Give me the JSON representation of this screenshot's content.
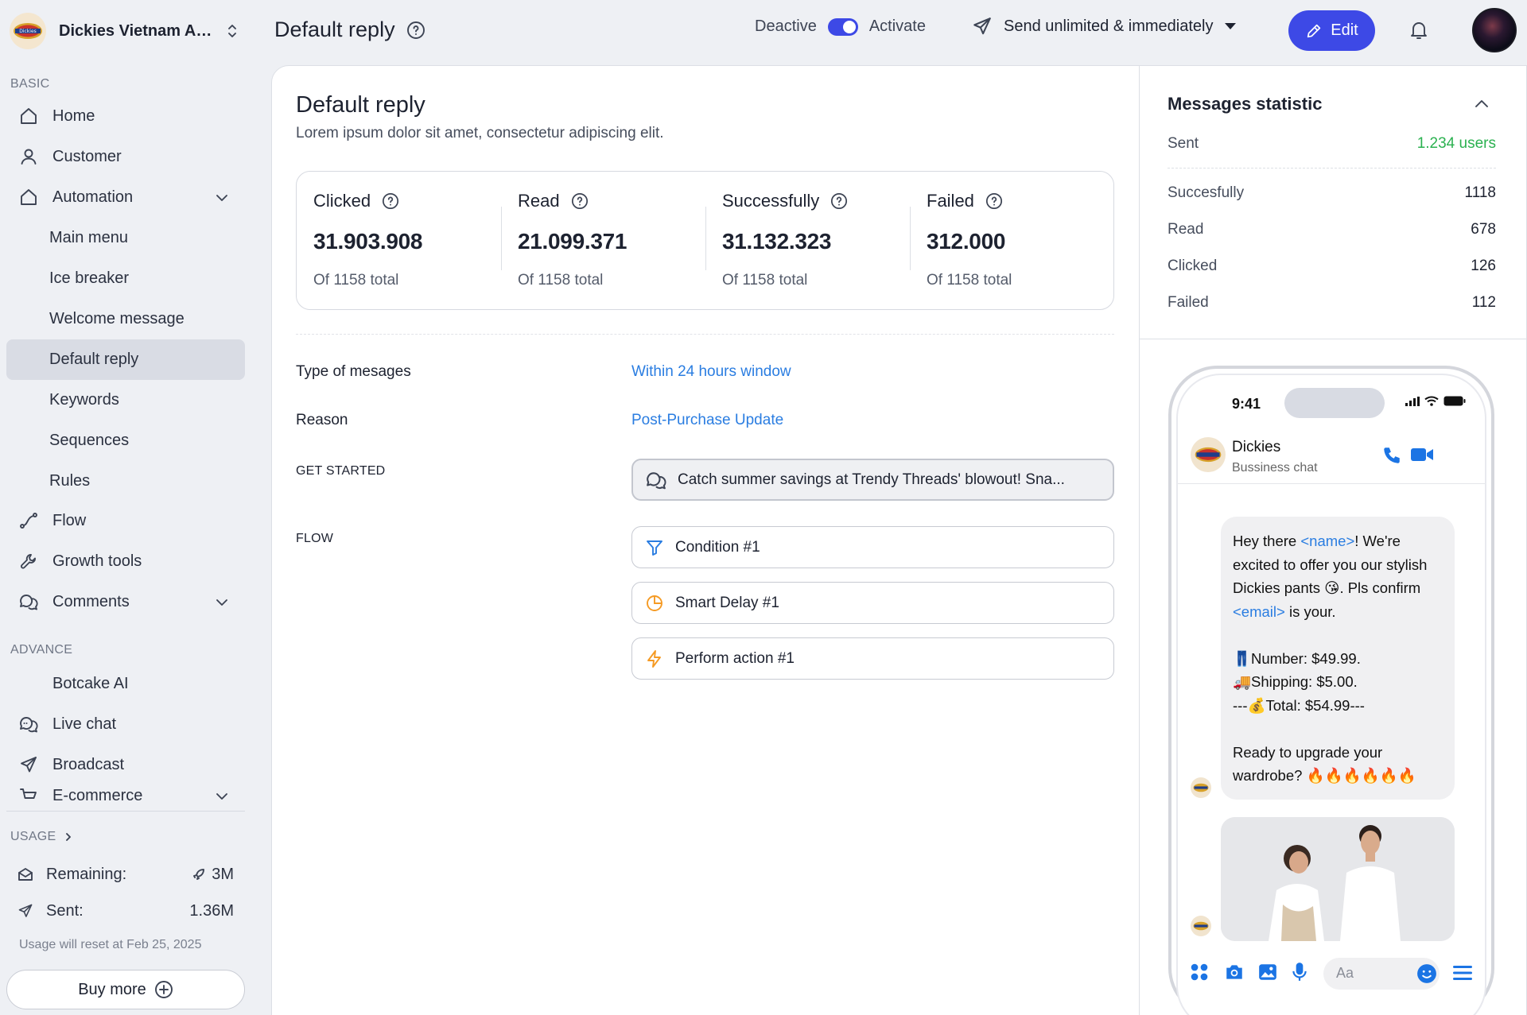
{
  "workspace": {
    "name": "Dickies Vietnam Aut...",
    "logo_text": "Dickies"
  },
  "sidebar": {
    "basic_label": "BASIC",
    "basic_items": [
      {
        "label": "Home",
        "icon": "home-icon"
      },
      {
        "label": "Customer",
        "icon": "user-icon"
      },
      {
        "label": "Automation",
        "icon": "home-icon",
        "expanded": true
      }
    ],
    "automation_children": [
      {
        "label": "Main menu"
      },
      {
        "label": "Ice breaker"
      },
      {
        "label": "Welcome message"
      },
      {
        "label": "Default reply",
        "active": true
      },
      {
        "label": "Keywords"
      },
      {
        "label": "Sequences"
      },
      {
        "label": "Rules"
      }
    ],
    "other_items": [
      {
        "label": "Flow",
        "icon": "flow-icon"
      },
      {
        "label": "Growth tools",
        "icon": "wrench-icon"
      },
      {
        "label": "Comments",
        "icon": "comments-icon"
      }
    ],
    "advance_label": "ADVANCE",
    "advance_items": [
      {
        "label": "Botcake AI"
      },
      {
        "label": "Live chat",
        "icon": "live-chat-icon"
      },
      {
        "label": "Broadcast",
        "icon": "send-icon"
      },
      {
        "label": "E-commerce",
        "icon": "cart-icon"
      }
    ],
    "usage_label": "USAGE",
    "usage": {
      "remaining_label": "Remaining:",
      "remaining_value": "3M",
      "sent_label": "Sent:",
      "sent_value": "1.36M",
      "reset_note": "Usage will reset at Feb 25, 2025"
    },
    "buy_more_label": "Buy more"
  },
  "header": {
    "title": "Default reply",
    "deactive_label": "Deactive",
    "activate_label": "Activate",
    "toggle_on": true,
    "send_mode": "Send unlimited & immediately",
    "edit_label": "Edit",
    "accent_color": "#3d49e6"
  },
  "content": {
    "title": "Default reply",
    "description": "Lorem ipsum dolor sit amet, consectetur adipiscing elit.",
    "stats": [
      {
        "label": "Clicked",
        "value": "31.903.908",
        "sub": "Of 1158 total"
      },
      {
        "label": "Read",
        "value": "21.099.371",
        "sub": "Of 1158 total"
      },
      {
        "label": "Successfully",
        "value": "31.132.323",
        "sub": "Of 1158 total"
      },
      {
        "label": "Failed",
        "value": "312.000",
        "sub": "Of 1158 total"
      }
    ],
    "type_label": "Type of mesages",
    "type_value": "Within 24 hours window",
    "reason_label": "Reason",
    "reason_value": "Post-Purchase Update",
    "get_started_label": "GET STARTED",
    "get_started_message": "Catch summer savings at Trendy Threads' blowout! Sna...",
    "flow_label": "FLOW",
    "flow_items": [
      {
        "label": "Condition #1",
        "icon": "filter-icon",
        "color": "#2a7de1"
      },
      {
        "label": "Smart Delay #1",
        "icon": "timer-icon",
        "color": "#f59a23"
      },
      {
        "label": "Perform action #1",
        "icon": "lightning-icon",
        "color": "#f59a23"
      }
    ]
  },
  "messages_statistic": {
    "title": "Messages statistic",
    "sent_label": "Sent",
    "sent_value": "1.234 users",
    "rows": [
      {
        "label": "Succesfully",
        "value": "1118"
      },
      {
        "label": "Read",
        "value": "678"
      },
      {
        "label": "Clicked",
        "value": "126"
      },
      {
        "label": "Failed",
        "value": "112"
      }
    ]
  },
  "phone": {
    "time": "9:41",
    "contact_name": "Dickies",
    "contact_status": "Bussiness chat",
    "message": {
      "greet_a": "Hey there ",
      "name_tag": "<name>",
      "greet_b": "! We're excited to offer you our stylish Dickies pants 😘. Pls confirm ",
      "email_tag": "<email>",
      "greet_c": " is your.",
      "number_line": "👖Number: $49.99.",
      "shipping_line": "🚚Shipping: $5.00.",
      "total_line": "---💰Total: $54.99---",
      "closing": "Ready to upgrade your wardrobe? 🔥🔥🔥🔥🔥🔥"
    },
    "input_placeholder": "Aa"
  }
}
